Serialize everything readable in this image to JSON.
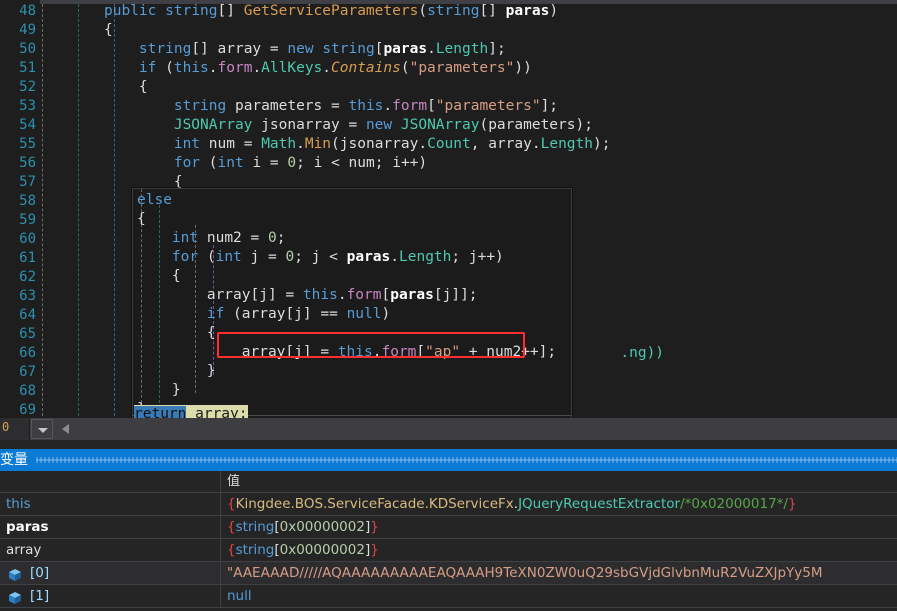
{
  "editor": {
    "line_numbers": [
      "48",
      "49",
      "50",
      "51",
      "52",
      "53",
      "54",
      "55",
      "56",
      "57",
      "58",
      "59",
      "60",
      "61",
      "62",
      "63",
      "64",
      "65",
      "66",
      "67",
      "68",
      "69"
    ],
    "background_code": [
      "public string[] GetServiceParameters(string[] paras)",
      "{",
      "    string[] array = new string[paras.Length];",
      "    if (this.form.AllKeys.Contains(\"parameters\"))",
      "    {",
      "        string parameters = this.form[\"parameters\"];",
      "        JSONArray jsonarray = new JSONArray(parameters);",
      "        int num = Math.Min(jsonarray.Count, array.Length);",
      "        for (int i = 0; i < num; i++)",
      "        {"
    ],
    "fragment_right": ".ng))",
    "overlay_code": [
      "else",
      "{",
      "    int num2 = 0;",
      "    for (int j = 0; j < paras.Length; j++)",
      "    {",
      "        array[j] = this.form[paras[j]];",
      "        if (array[j] == null)",
      "        {",
      "            array[j] = this.form[\"ap\" + num2++];",
      "        }",
      "    }",
      "}"
    ],
    "highlighted_statement": "array[j] = this.form[\"ap\" + num2++];",
    "return_line": {
      "selected_text": "return",
      "trailing_text": " array;"
    },
    "scrollbar": {
      "combo_value": "0",
      "dropdown_icon": "chevron-down-icon",
      "left_arrow_icon": "scroll-left-arrow-icon"
    },
    "annotation_color": "#ff2e2e"
  },
  "variables_panel": {
    "title": "变量",
    "columns": [
      "",
      "值"
    ],
    "rows": [
      {
        "name": "this",
        "name_style": "keyword",
        "icon": null,
        "value_parts": [
          {
            "t": "{",
            "c": "brace"
          },
          {
            "t": "Kingdee.BOS.ServiceFacade.KDServiceFx",
            "c": "ns"
          },
          {
            "t": ".",
            "c": "gray"
          },
          {
            "t": "JQueryRequestExtractor",
            "c": "type"
          },
          {
            "t": "/*0x02000017*/",
            "c": "comment"
          },
          {
            "t": "}",
            "c": "brace"
          }
        ]
      },
      {
        "name": "paras",
        "name_style": "bold",
        "icon": null,
        "value_parts": [
          {
            "t": "{",
            "c": "brace"
          },
          {
            "t": "string",
            "c": "keyword"
          },
          {
            "t": "[",
            "c": "gray"
          },
          {
            "t": "0x00000002",
            "c": "number"
          },
          {
            "t": "]",
            "c": "gray"
          },
          {
            "t": "}",
            "c": "brace"
          }
        ]
      },
      {
        "name": "array",
        "name_style": "normal",
        "icon": null,
        "value_parts": [
          {
            "t": "{",
            "c": "brace"
          },
          {
            "t": "string",
            "c": "keyword"
          },
          {
            "t": "[",
            "c": "gray"
          },
          {
            "t": "0x00000002",
            "c": "number"
          },
          {
            "t": "]",
            "c": "gray"
          },
          {
            "t": "}",
            "c": "brace"
          }
        ]
      },
      {
        "name": "[0]",
        "name_style": "element",
        "icon": "cube-icon",
        "highlighted": true,
        "value_parts": [
          {
            "t": "\"AAEAAAD/////AQAAAAAAAAAEAQAAAH9TeXN0ZW0uQ29sbGVjdGlvbnMuR2VuZXJpYy5M",
            "c": "string"
          }
        ]
      },
      {
        "name": "[1]",
        "name_style": "element",
        "icon": "cube-icon",
        "highlighted": false,
        "value_parts": [
          {
            "t": "null",
            "c": "keyword"
          }
        ]
      }
    ]
  },
  "colors": {
    "accent_blue": "#0a7ad4",
    "editor_bg": "#1e1e1e",
    "panel_bg": "#252526",
    "annotation_red": "#ff2e2e",
    "highlight_yellow": "#dcdcaa",
    "selection_blue": "#3a7ab5"
  }
}
